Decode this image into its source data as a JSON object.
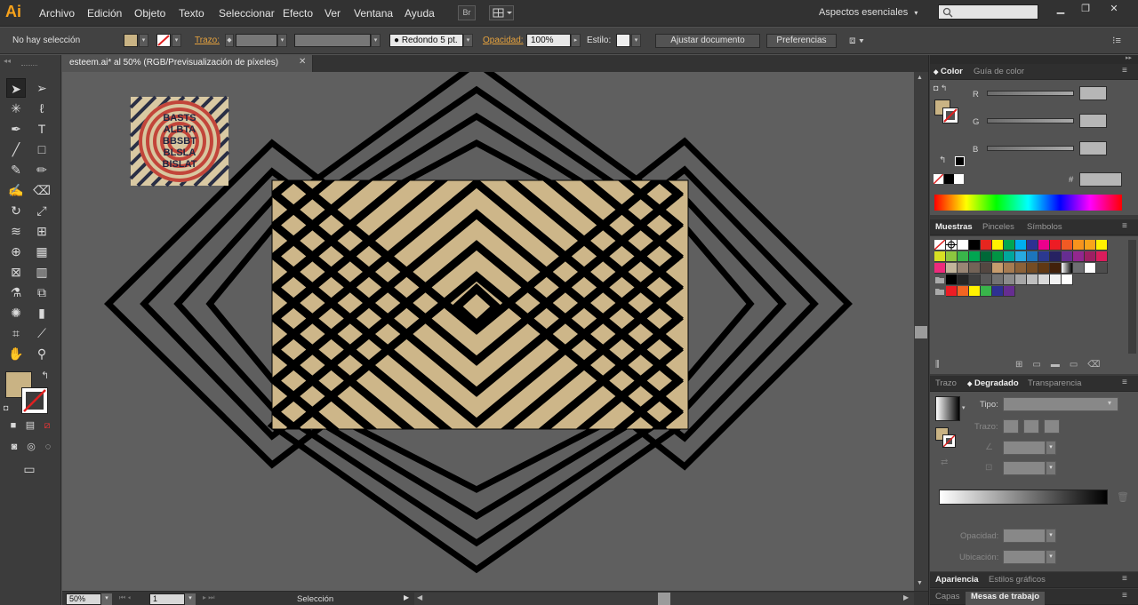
{
  "app": {
    "logo": "Ai"
  },
  "menu": [
    "Archivo",
    "Edición",
    "Objeto",
    "Texto",
    "Seleccionar",
    "Efecto",
    "Ver",
    "Ventana",
    "Ayuda"
  ],
  "menubar": {
    "bridge_label": "Br",
    "workspace": "Aspectos esenciales",
    "win_minimize": "▁",
    "win_restore": "❐",
    "win_close": "✕"
  },
  "control": {
    "selection_status": "No hay selección",
    "stroke_label": "Trazo:",
    "brush_value": "Redondo 5 pt.",
    "opacity_label": "Opacidad:",
    "opacity_value": "100%",
    "style_label": "Estilo:",
    "fit_doc_button": "Ajustar documento",
    "prefs_button": "Preferencias"
  },
  "document": {
    "tab_title": "esteem.ai* al 50% (RGB/Previsualización de píxeles)",
    "close": "✕"
  },
  "status": {
    "zoom": "50%",
    "page": "1",
    "tool_status": "Selección"
  },
  "color_panel": {
    "tab_active": "Color",
    "tab_inactive": "Guía de color",
    "channels": [
      "R",
      "G",
      "B"
    ],
    "hex_symbol": "#"
  },
  "swatches_panel": {
    "tabs": [
      "Muestras",
      "Pinceles",
      "Símbolos"
    ]
  },
  "gradient_panel": {
    "tabs": [
      "Trazo",
      "Degradado",
      "Transparencia"
    ],
    "type_label": "Tipo:",
    "strokes_label": "Trazo:",
    "opacity_label": "Opacidad:",
    "location_label": "Ubicación:"
  },
  "bottom_panels": {
    "row1": [
      "Apariencia",
      "Estilos gráficos"
    ],
    "row2": [
      "Capas",
      "Mesas de trabajo"
    ]
  },
  "colors": {
    "fill": "#c9b384",
    "accent_orange": "#f7a21b",
    "canvas": "#5f5f5f",
    "artboard": "#cdb689"
  },
  "thumbnail": {
    "text_rows": [
      "BASTS",
      "ALBTA",
      "BBSBT",
      "BLSLA",
      "BISLAT"
    ]
  }
}
